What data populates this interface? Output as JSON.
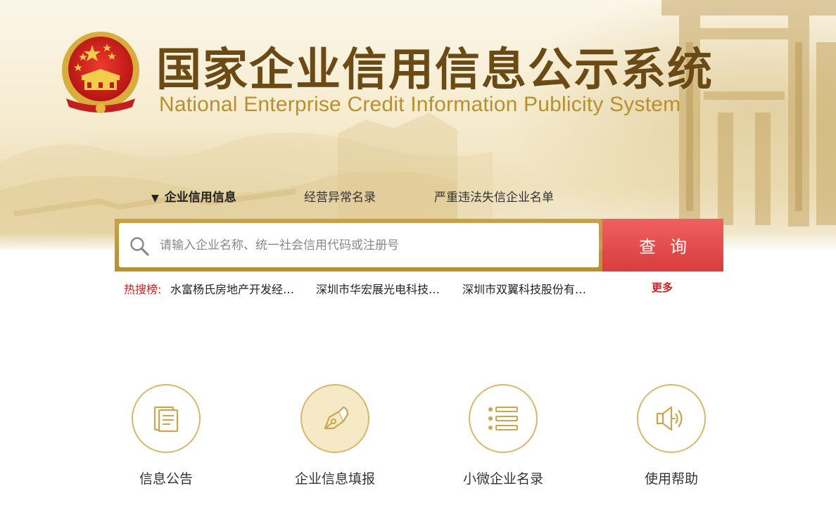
{
  "header": {
    "title_cn": "国家企业信用信息公示系统",
    "title_en": "National Enterprise Credit Information Publicity System"
  },
  "tabs": [
    {
      "label": "企业信用信息",
      "active": true
    },
    {
      "label": "经营异常名录",
      "active": false
    },
    {
      "label": "严重违法失信企业名单",
      "active": false
    }
  ],
  "search": {
    "placeholder": "请输入企业名称、统一社会信用代码或注册号",
    "value": "",
    "button_label": "查询"
  },
  "hot_search": {
    "label": "热搜榜:",
    "items": [
      "水富杨氏房地产开发经…",
      "深圳市华宏展光电科技…",
      "深圳市双翼科技股份有…"
    ],
    "more_label": "更多"
  },
  "features": [
    {
      "label": "信息公告",
      "icon": "document-icon"
    },
    {
      "label": "企业信息填报",
      "icon": "pen-nib-icon"
    },
    {
      "label": "小微企业名录",
      "icon": "list-icon"
    },
    {
      "label": "使用帮助",
      "icon": "speaker-icon"
    }
  ],
  "colors": {
    "brand_gold": "#b8902e",
    "title_brown": "#6b4a14",
    "search_button_red": "#e04848",
    "hot_red": "#d21f1f"
  }
}
